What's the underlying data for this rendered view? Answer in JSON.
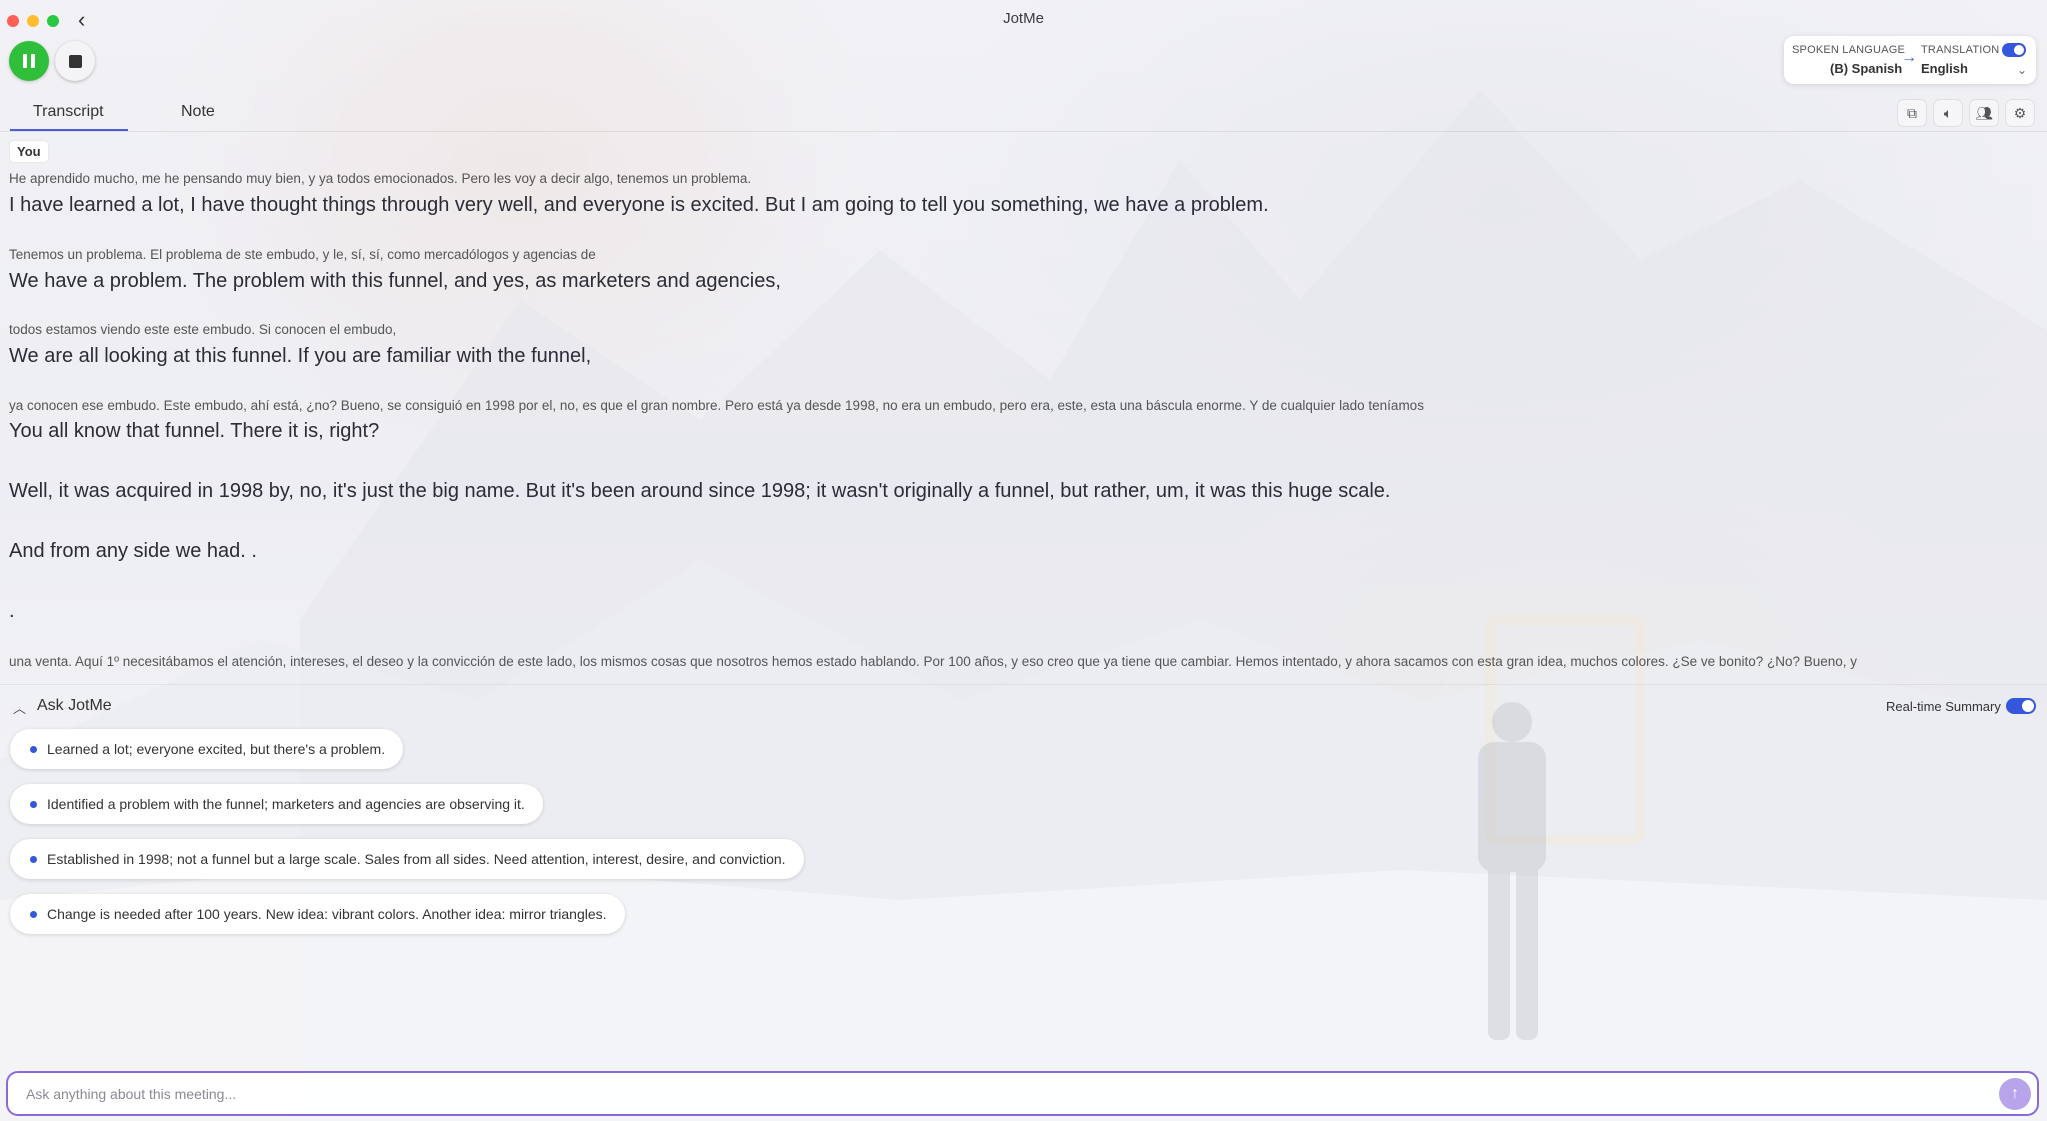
{
  "window": {
    "title": "JotMe"
  },
  "language_panel": {
    "spoken_label": "SPOKEN LANGUAGE",
    "spoken_value": "(B) Spanish",
    "translation_label": "TRANSLATION",
    "translation_value": "English",
    "translation_enabled": true
  },
  "tabs": [
    {
      "label": "Transcript",
      "active": true
    },
    {
      "label": "Note",
      "active": false
    }
  ],
  "toolbar_icons": [
    "copy-icon",
    "speaker-icon",
    "participants-icon",
    "settings-icon"
  ],
  "transcript": {
    "speaker": "You",
    "blocks": [
      {
        "source": "He aprendido mucho, me he pensando muy bien, y ya todos emocionados. Pero les voy a decir algo, tenemos un problema.",
        "translation": "I have learned a lot, I have thought things through very well, and everyone is excited. But I am going to tell you something, we have a problem."
      },
      {
        "source": "Tenemos un problema. El problema de ste embudo, y le, sí, sí, como mercadólogos y agencias de",
        "translation": "We have a problem. The problem with this funnel, and yes, as marketers and agencies,"
      },
      {
        "source": "todos estamos viendo este este embudo. Si conocen el embudo,",
        "translation": "We are all looking at this funnel. If you are familiar with the funnel,"
      },
      {
        "source": "ya conocen ese embudo. Este embudo, ahí está, ¿no? Bueno, se consiguió en 1998 por el, no, es que el gran nombre. Pero está ya desde 1998, no era un embudo, pero era, este, esta una báscula enorme. Y de cualquier lado teníamos",
        "translation": "You all know that funnel. There it is, right?",
        "translation_2": "Well, it was acquired in 1998 by, no, it's just the big name. But it's been around since 1998; it wasn't originally a funnel, but rather, um, it was this huge scale.",
        "translation_3": "And from any side we had. .",
        "translation_4": "."
      },
      {
        "source": "una venta. Aquí 1º necesitábamos el atención, intereses, el deseo y la convicción de este lado, los mismos cosas que nosotros hemos estado hablando. Por 100 años, y eso creo que ya tiene que cambiar. Hemos intentado, y ahora sacamos con esta gran idea, muchos colores. ¿Se ve bonito? ¿No? Bueno, y"
      }
    ]
  },
  "ask": {
    "title": "Ask JotMe",
    "realtime_label": "Real-time Summary",
    "realtime_enabled": true,
    "summaries": [
      "Learned a lot; everyone excited, but there's a problem.",
      "Identified a problem with the funnel; marketers and agencies are observing it.",
      "Established in 1998; not a funnel but a large scale. Sales from all sides. Need attention, interest, desire, and conviction.",
      "Change is needed after 100 years. New idea: vibrant colors. Another idea: mirror triangles."
    ],
    "input_placeholder": "Ask anything about this meeting...",
    "input_value": ""
  },
  "colors": {
    "accent": "#3457dc",
    "record": "#2fbf3a",
    "input_border": "#8a6ad9"
  }
}
